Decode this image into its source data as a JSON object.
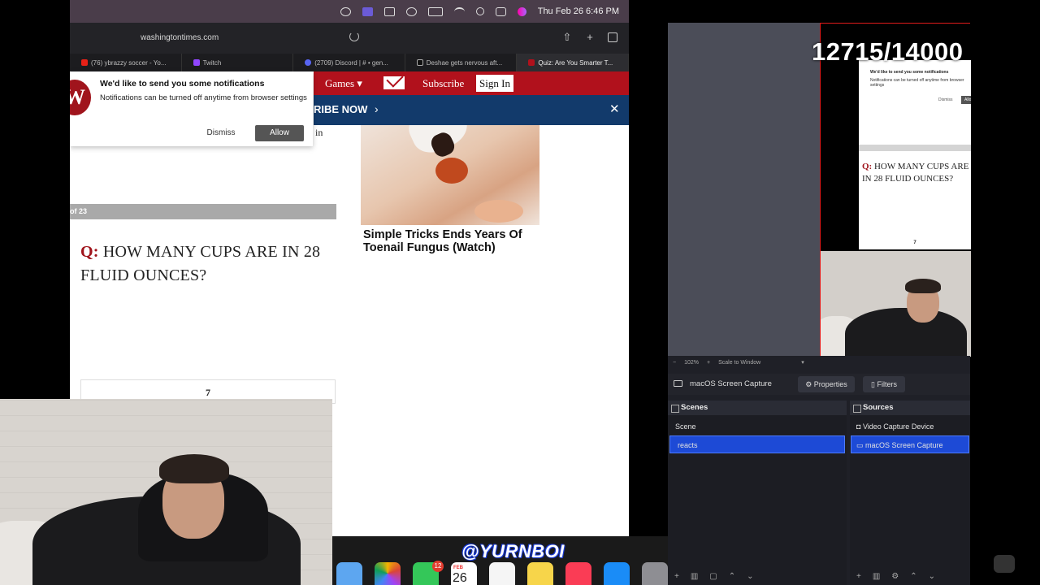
{
  "menubar": {
    "datetime": "Thu Feb 26  6:46 PM"
  },
  "browser": {
    "url": "washingtontimes.com",
    "tabs": [
      {
        "label": "(76) ybrazzy soccer - Yo...",
        "color": "#e62117"
      },
      {
        "label": "Twitch",
        "color": "#9146ff"
      },
      {
        "label": "(2709) Discord | # • gen...",
        "color": "#5865f2"
      },
      {
        "label": "Deshae gets nervous aft...",
        "color": "#111111"
      },
      {
        "label": "Quiz: Are You Smarter T...",
        "color": "#b1111c"
      }
    ]
  },
  "site": {
    "nav": {
      "games": "Games ▾",
      "subscribe": "Subscribe",
      "signin": "Sign In"
    },
    "promo": {
      "text": "RIBE NOW",
      "chevron": "›",
      "close": "✕"
    },
    "nav_in": "in",
    "logo": "W"
  },
  "notification": {
    "title": "We'd like to send you some notifications",
    "body": "Notifications can be turned off anytime from browser settings",
    "dismiss": "Dismiss",
    "allow": "Allow"
  },
  "quiz": {
    "counter": "of 23",
    "prefix": "Q:",
    "question": "HOW MANY CUPS ARE IN 28 FLUID OUNCES?",
    "answer": "7"
  },
  "ad": {
    "headline": "Simple Tricks Ends Years Of Toenail Fungus (Watch)"
  },
  "overlay": {
    "handle": "@YURNBOI",
    "goal": "12715/14000"
  },
  "dock": {
    "badge": "12",
    "cal_month": "FEB",
    "cal_day": "26"
  },
  "obs": {
    "preview_q": "HOW MANY CUPS ARE IN 28 FLUID OUNCES?",
    "zoom": "102%",
    "scale_mode": "Scale to Window",
    "source_name": "macOS Screen Capture",
    "properties": "Properties",
    "filters": "Filters",
    "scenes_title": "Scenes",
    "scenes": [
      "Scene",
      "reacts"
    ],
    "sources_title": "Sources",
    "sources": [
      "Video Capture Device",
      "macOS Screen Capture"
    ]
  }
}
